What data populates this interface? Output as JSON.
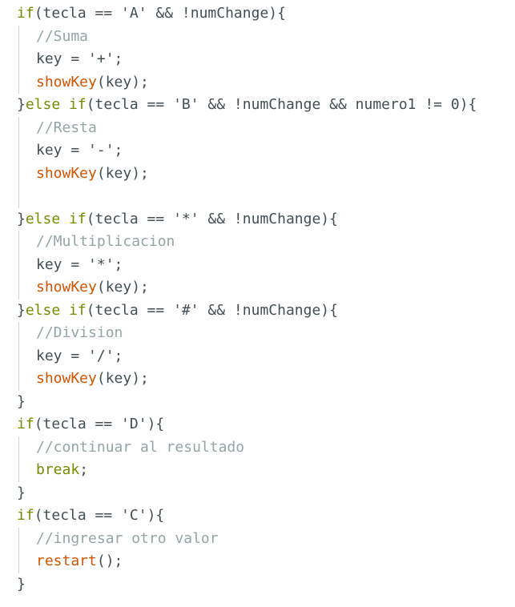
{
  "editor": {
    "colors": {
      "keyword": "#728e00",
      "function": "#d35400",
      "comment": "#95a5a6",
      "text": "#434f54",
      "indent_guide": "#cfd4d6",
      "background": "#ffffff"
    },
    "lines": [
      {
        "indent": false,
        "tokens": [
          {
            "t": "kw",
            "v": "if"
          },
          {
            "t": "plain",
            "v": "(tecla == 'A' && !numChange){"
          }
        ]
      },
      {
        "indent": true,
        "tokens": [
          {
            "t": "cm",
            "v": "//Suma"
          }
        ]
      },
      {
        "indent": true,
        "tokens": [
          {
            "t": "plain",
            "v": "key = '+';"
          }
        ]
      },
      {
        "indent": true,
        "tokens": [
          {
            "t": "fn",
            "v": "showKey"
          },
          {
            "t": "plain",
            "v": "(key);"
          }
        ]
      },
      {
        "indent": false,
        "tokens": [
          {
            "t": "plain",
            "v": "}"
          },
          {
            "t": "kw",
            "v": "else if"
          },
          {
            "t": "plain",
            "v": "(tecla == 'B' && !numChange && numero1 != 0){"
          }
        ]
      },
      {
        "indent": true,
        "tokens": [
          {
            "t": "cm",
            "v": "//Resta"
          }
        ]
      },
      {
        "indent": true,
        "tokens": [
          {
            "t": "plain",
            "v": "key = '-';"
          }
        ]
      },
      {
        "indent": true,
        "tokens": [
          {
            "t": "fn",
            "v": "showKey"
          },
          {
            "t": "plain",
            "v": "(key);"
          }
        ]
      },
      {
        "indent": true,
        "tokens": []
      },
      {
        "indent": false,
        "tokens": [
          {
            "t": "plain",
            "v": "}"
          },
          {
            "t": "kw",
            "v": "else if"
          },
          {
            "t": "plain",
            "v": "(tecla == '*' && !numChange){"
          }
        ]
      },
      {
        "indent": true,
        "tokens": [
          {
            "t": "cm",
            "v": "//Multiplicacion"
          }
        ]
      },
      {
        "indent": true,
        "tokens": [
          {
            "t": "plain",
            "v": "key = '*';"
          }
        ]
      },
      {
        "indent": true,
        "tokens": [
          {
            "t": "fn",
            "v": "showKey"
          },
          {
            "t": "plain",
            "v": "(key);"
          }
        ]
      },
      {
        "indent": false,
        "tokens": [
          {
            "t": "plain",
            "v": "}"
          },
          {
            "t": "kw",
            "v": "else if"
          },
          {
            "t": "plain",
            "v": "(tecla == '#' && !numChange){"
          }
        ]
      },
      {
        "indent": true,
        "tokens": [
          {
            "t": "cm",
            "v": "//Division"
          }
        ]
      },
      {
        "indent": true,
        "tokens": [
          {
            "t": "plain",
            "v": "key = '/';"
          }
        ]
      },
      {
        "indent": true,
        "tokens": [
          {
            "t": "fn",
            "v": "showKey"
          },
          {
            "t": "plain",
            "v": "(key);"
          }
        ]
      },
      {
        "indent": false,
        "tokens": [
          {
            "t": "plain",
            "v": "}"
          }
        ]
      },
      {
        "indent": false,
        "tokens": [
          {
            "t": "kw",
            "v": "if"
          },
          {
            "t": "plain",
            "v": "(tecla == 'D'){"
          }
        ]
      },
      {
        "indent": true,
        "tokens": [
          {
            "t": "cm",
            "v": "//continuar al resultado"
          }
        ]
      },
      {
        "indent": true,
        "tokens": [
          {
            "t": "kw",
            "v": "break"
          },
          {
            "t": "plain",
            "v": ";"
          }
        ]
      },
      {
        "indent": false,
        "tokens": [
          {
            "t": "plain",
            "v": "}"
          }
        ]
      },
      {
        "indent": false,
        "tokens": [
          {
            "t": "kw",
            "v": "if"
          },
          {
            "t": "plain",
            "v": "(tecla == 'C'){"
          }
        ]
      },
      {
        "indent": true,
        "tokens": [
          {
            "t": "cm",
            "v": "//ingresar otro valor"
          }
        ]
      },
      {
        "indent": true,
        "tokens": [
          {
            "t": "fn",
            "v": "restart"
          },
          {
            "t": "plain",
            "v": "();"
          }
        ]
      },
      {
        "indent": false,
        "tokens": [
          {
            "t": "plain",
            "v": "}"
          }
        ]
      }
    ]
  }
}
